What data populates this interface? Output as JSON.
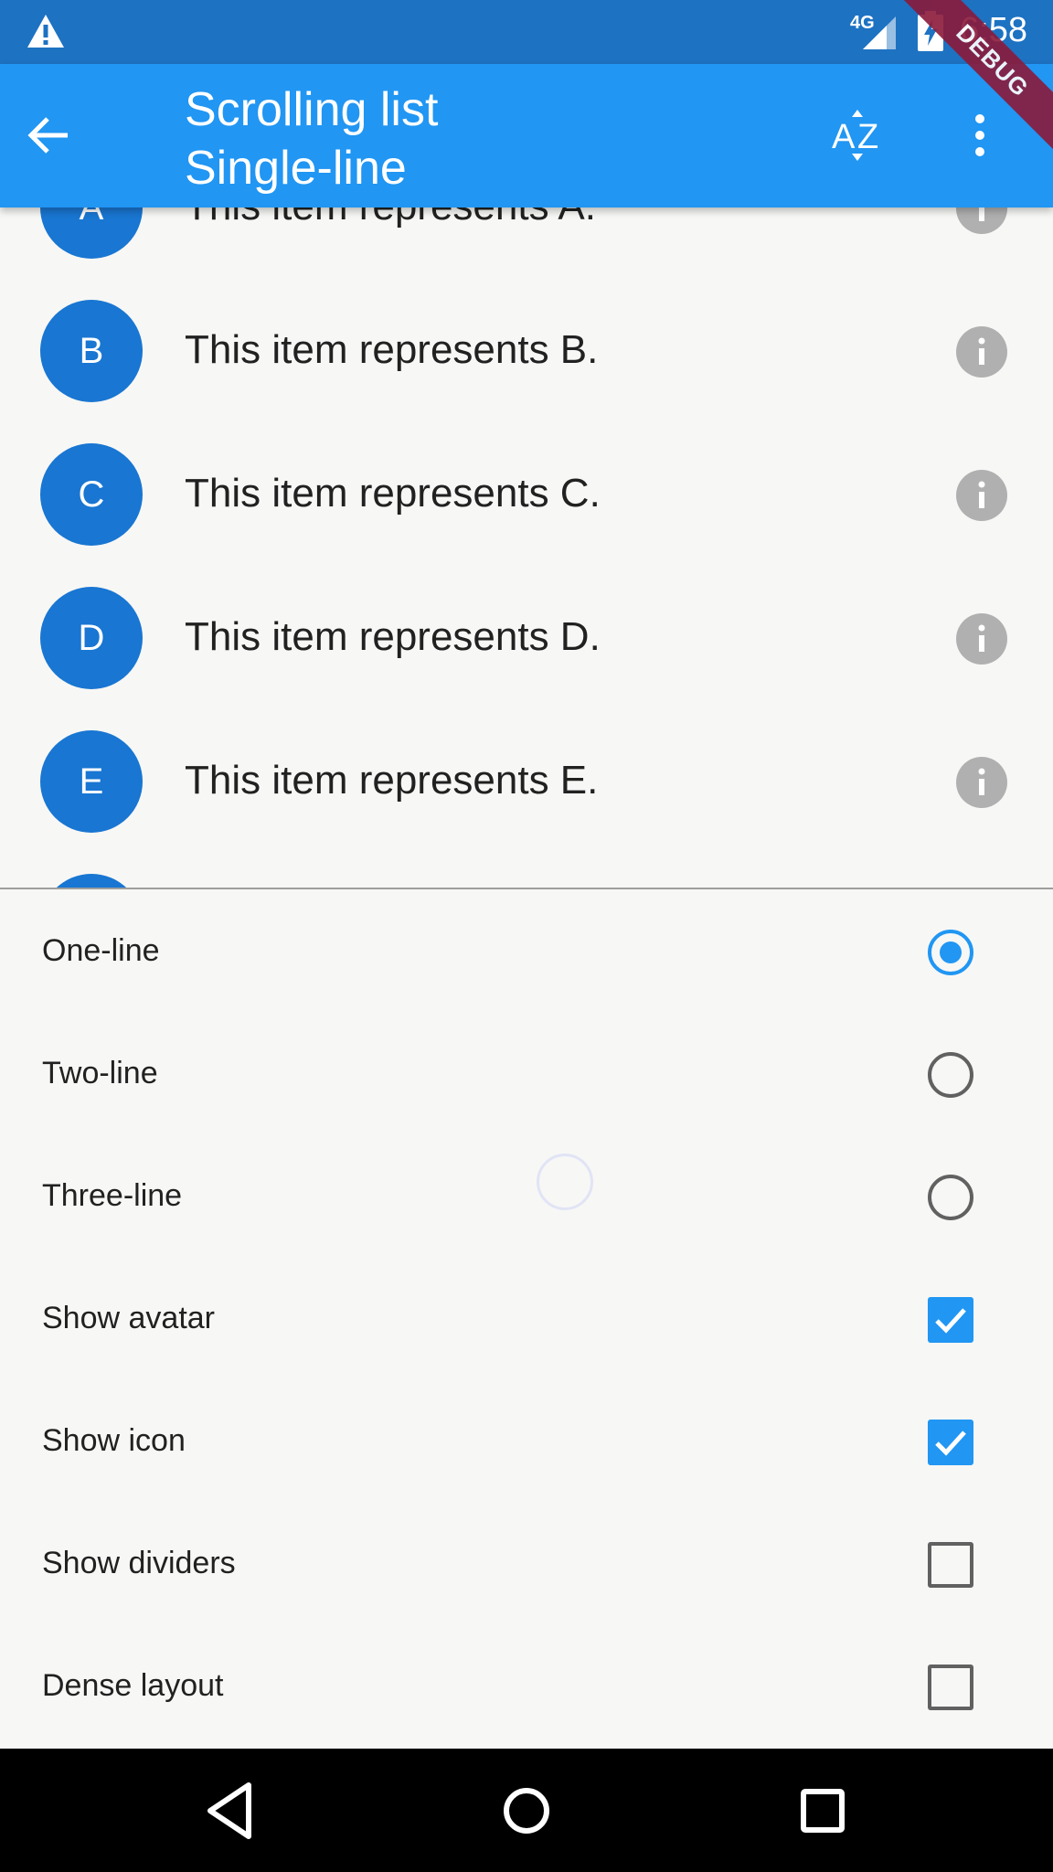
{
  "status_bar": {
    "network_label": "4G",
    "time": "6:58"
  },
  "app_bar": {
    "title_line1": "Scrolling list",
    "title_line2": "Single-line",
    "icons": [
      "back-arrow-icon",
      "sort-az-icon",
      "more-vert-icon"
    ]
  },
  "debug_banner": "DEBUG",
  "list": {
    "items": [
      {
        "letter": "A",
        "text": "This item represents A."
      },
      {
        "letter": "B",
        "text": "This item represents B."
      },
      {
        "letter": "C",
        "text": "This item represents C."
      },
      {
        "letter": "D",
        "text": "This item represents D."
      },
      {
        "letter": "E",
        "text": "This item represents E."
      }
    ]
  },
  "options": {
    "one_line": "One-line",
    "two_line": "Two-line",
    "three_line": "Three-line",
    "show_avatar": "Show avatar",
    "show_icon": "Show icon",
    "show_dividers": "Show dividers",
    "dense_layout": "Dense layout",
    "selected_layout": "One-line",
    "checked": {
      "show_avatar": true,
      "show_icon": true,
      "show_dividers": false,
      "dense_layout": false
    }
  },
  "colors": {
    "primary": "#2196f3",
    "status_bar": "#1d72c2",
    "avatar": "#1976d2",
    "debug_ribbon": "#8b1a3a"
  }
}
